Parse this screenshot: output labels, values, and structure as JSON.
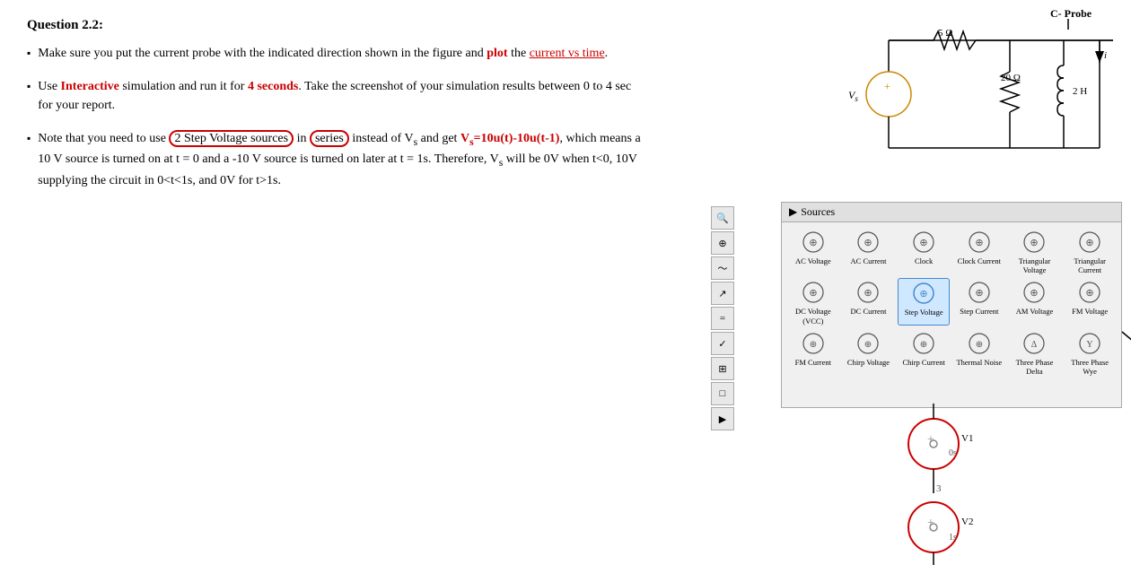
{
  "page": {
    "title": "Question 2.2"
  },
  "question": {
    "number": "Question 2.2:",
    "bullets": [
      {
        "id": "bullet1",
        "text_parts": [
          {
            "type": "normal",
            "text": "Make sure you put the current probe with the indicated direction shown in the figure and "
          },
          {
            "type": "red-bold",
            "text": "plot"
          },
          {
            "type": "normal",
            "text": " the "
          },
          {
            "type": "red-underline",
            "text": "current vs time"
          },
          {
            "type": "normal",
            "text": "."
          }
        ]
      },
      {
        "id": "bullet2",
        "text_parts": [
          {
            "type": "normal",
            "text": "Use "
          },
          {
            "type": "red-bold",
            "text": "Interactive"
          },
          {
            "type": "normal",
            "text": " simulation and run it for "
          },
          {
            "type": "red-bold",
            "text": "4 seconds"
          },
          {
            "type": "normal",
            "text": ". Take the screenshot of your simulation results between 0 to 4 sec for your report."
          }
        ]
      },
      {
        "id": "bullet3",
        "text_parts": [
          {
            "type": "normal",
            "text": "Note that you need to use "
          },
          {
            "type": "circled",
            "text": "2 Step Voltage sources"
          },
          {
            "type": "normal",
            "text": " in "
          },
          {
            "type": "circled",
            "text": "series"
          },
          {
            "type": "normal",
            "text": " instead of V"
          },
          {
            "type": "sub",
            "text": "s"
          },
          {
            "type": "normal",
            "text": " and get "
          },
          {
            "type": "red-bold",
            "text": "V"
          },
          {
            "type": "red-bold-sub",
            "text": "s"
          },
          {
            "type": "red-bold",
            "text": "=10u(t)-10u(t-1)"
          },
          {
            "type": "normal",
            "text": ", which means a 10 V source is turned on at t = 0 and a -10 V source is turned on later at t = 1s. Therefore, V"
          },
          {
            "type": "sub",
            "text": "s"
          },
          {
            "type": "normal",
            "text": " will be 0V when t<0, 10V supplying the circuit in 0<t<1s, and 0V for t>1s."
          }
        ]
      }
    ]
  },
  "circuit": {
    "resistor1_label": "5 Ω",
    "resistor2_label": "20 Ω",
    "inductor_label": "2 H",
    "source_label": "Vs",
    "current_label": "i",
    "probe_label": "C- Probe"
  },
  "sources_panel": {
    "header": "Sources",
    "items": [
      {
        "id": "ac-voltage",
        "label": "AC Voltage"
      },
      {
        "id": "ac-current",
        "label": "AC Current"
      },
      {
        "id": "clock",
        "label": "Clock"
      },
      {
        "id": "clock-current",
        "label": "Clock Current"
      },
      {
        "id": "triangular-voltage",
        "label": "Triangular Voltage"
      },
      {
        "id": "triangular-current",
        "label": "Triangular Current"
      },
      {
        "id": "dc-voltage",
        "label": "DC Voltage (VCC)"
      },
      {
        "id": "dc-current",
        "label": "DC Current"
      },
      {
        "id": "step-voltage",
        "label": "Step Voltage",
        "highlighted": true
      },
      {
        "id": "step-current",
        "label": "Step Current"
      },
      {
        "id": "am-voltage",
        "label": "AM Voltage"
      },
      {
        "id": "fm-voltage",
        "label": "FM Voltage"
      },
      {
        "id": "fm-current",
        "label": "FM Current"
      },
      {
        "id": "chirp-voltage",
        "label": "Chirp Voltage"
      },
      {
        "id": "chirp-current",
        "label": "Chirp Current"
      },
      {
        "id": "thermal-noise",
        "label": "Thermal Noise"
      },
      {
        "id": "three-phase-delta",
        "label": "Three Phase Delta"
      },
      {
        "id": "three-phase-wye",
        "label": "Three Phase Wye"
      }
    ]
  },
  "schematic": {
    "v1_label": "V1",
    "v1_time": "0s",
    "v1_value": "3",
    "v2_label": "V2",
    "v2_time": "1s"
  }
}
